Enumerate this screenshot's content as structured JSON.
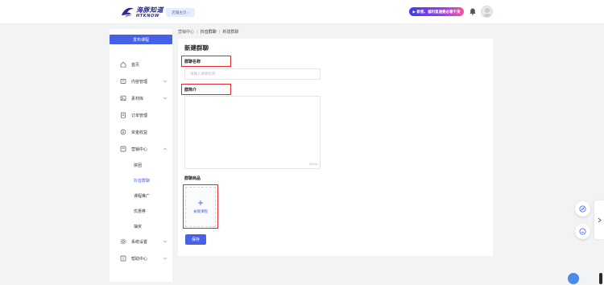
{
  "header": {
    "logo_cn": "海豚知道",
    "logo_en": "HTKNOW",
    "shop_button": "店铺主页 ›",
    "promo_label": "▶ 新客、福利直通要必看干货"
  },
  "sidebar": {
    "publish_button": "发布课程",
    "items": [
      {
        "label": "首页",
        "icon": "home-icon",
        "expandable": false
      },
      {
        "label": "内容管理",
        "icon": "content-icon",
        "expandable": true
      },
      {
        "label": "素材库",
        "icon": "material-icon",
        "expandable": true
      },
      {
        "label": "订单管理",
        "icon": "order-icon",
        "expandable": false
      },
      {
        "label": "资金收益",
        "icon": "money-icon",
        "expandable": false
      },
      {
        "label": "营销中心",
        "icon": "marketing-icon",
        "expandable": true,
        "expanded": true
      },
      {
        "label": "系统设置",
        "icon": "settings-icon",
        "expandable": true
      },
      {
        "label": "帮助中心",
        "icon": "help-icon",
        "expandable": true
      }
    ],
    "sub_items": [
      {
        "label": "拼团",
        "active": false
      },
      {
        "label": "抖音群聊",
        "active": true
      },
      {
        "label": "课程推广",
        "active": false
      },
      {
        "label": "优惠券",
        "active": false
      },
      {
        "label": "抽奖",
        "active": false
      }
    ]
  },
  "breadcrumb": {
    "items": [
      "营销中心",
      "抖音群聊",
      "新建群聊"
    ],
    "separator": "/"
  },
  "form": {
    "title": "新建群聊",
    "name_label": "群聊名称",
    "name_placeholder": "请输入群聊名称",
    "name_value": "",
    "intro_label": "群简介",
    "intro_value": "",
    "intro_counter": "0/100",
    "product_label": "群聊商品",
    "add_course_plus": "+",
    "add_course_label": "关联课程",
    "save_button": "保存"
  },
  "colors": {
    "primary": "#4760e8",
    "highlight": "#e22a2a",
    "background": "#f2f3f5"
  }
}
